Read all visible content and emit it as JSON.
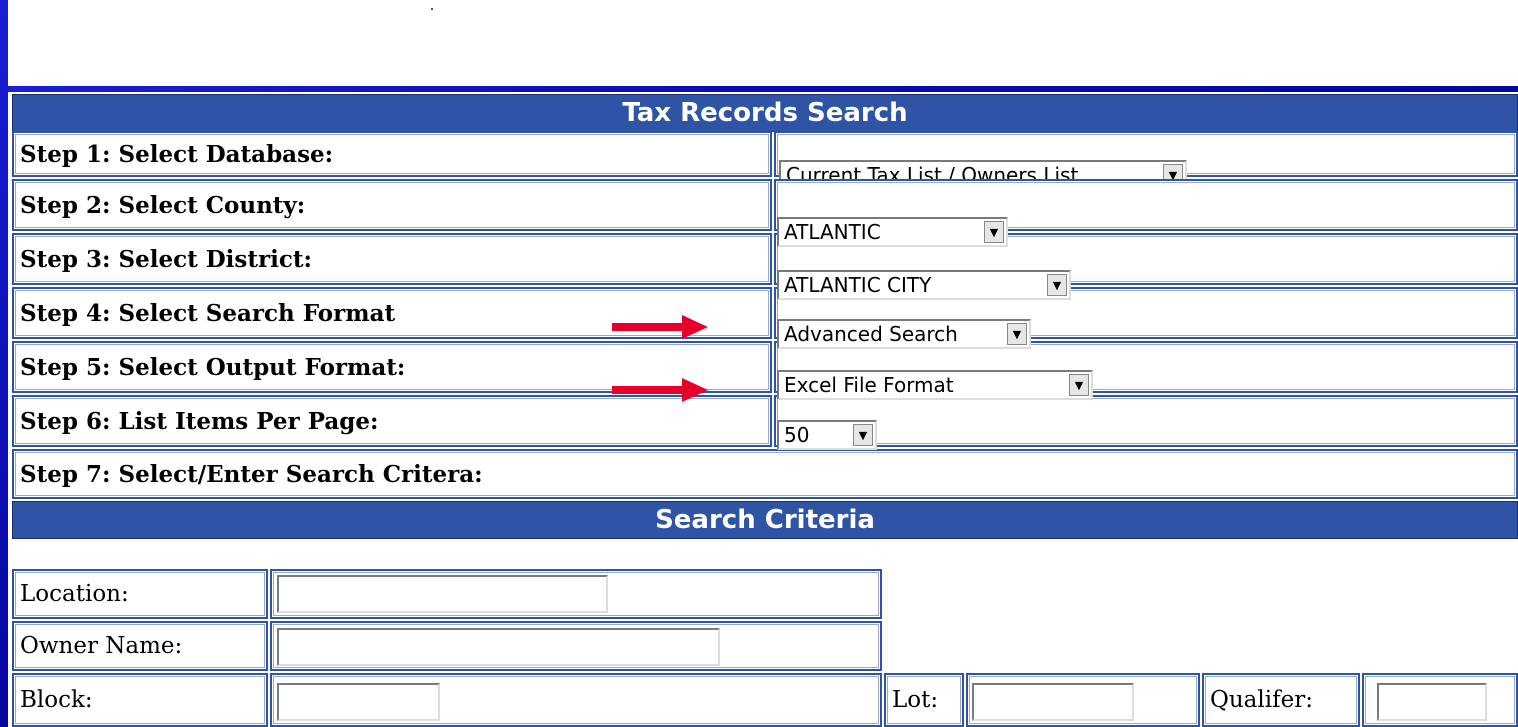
{
  "header": {
    "title": "Tax Records Search"
  },
  "steps": [
    {
      "label": "Step 1: Select Database:",
      "value": "Current Tax List / Owners List"
    },
    {
      "label": "Step 2: Select County:",
      "value": "ATLANTIC"
    },
    {
      "label": "Step 3: Select District:",
      "value": "ATLANTIC CITY"
    },
    {
      "label": "Step 4: Select Search Format",
      "value": "Advanced Search"
    },
    {
      "label": "Step 5: Select Output Format:",
      "value": "Excel File Format"
    },
    {
      "label": "Step 6: List Items Per Page:",
      "value": "50"
    },
    {
      "label": "Step 7: Select/Enter Search Critera:"
    }
  ],
  "criteria": {
    "title": "Search Criteria",
    "location_label": "Location:",
    "owner_label": "Owner Name:",
    "block_label": "Block:",
    "lot_label": "Lot:",
    "qualifier_label": "Qualifer:",
    "location_value": "",
    "owner_value": "",
    "block_value": "",
    "lot_value": "",
    "qualifier_value": ""
  },
  "colors": {
    "header_bar": "#2f54a6",
    "frame": "#0a0fb0",
    "annotation_arrow": "#e8002a"
  }
}
